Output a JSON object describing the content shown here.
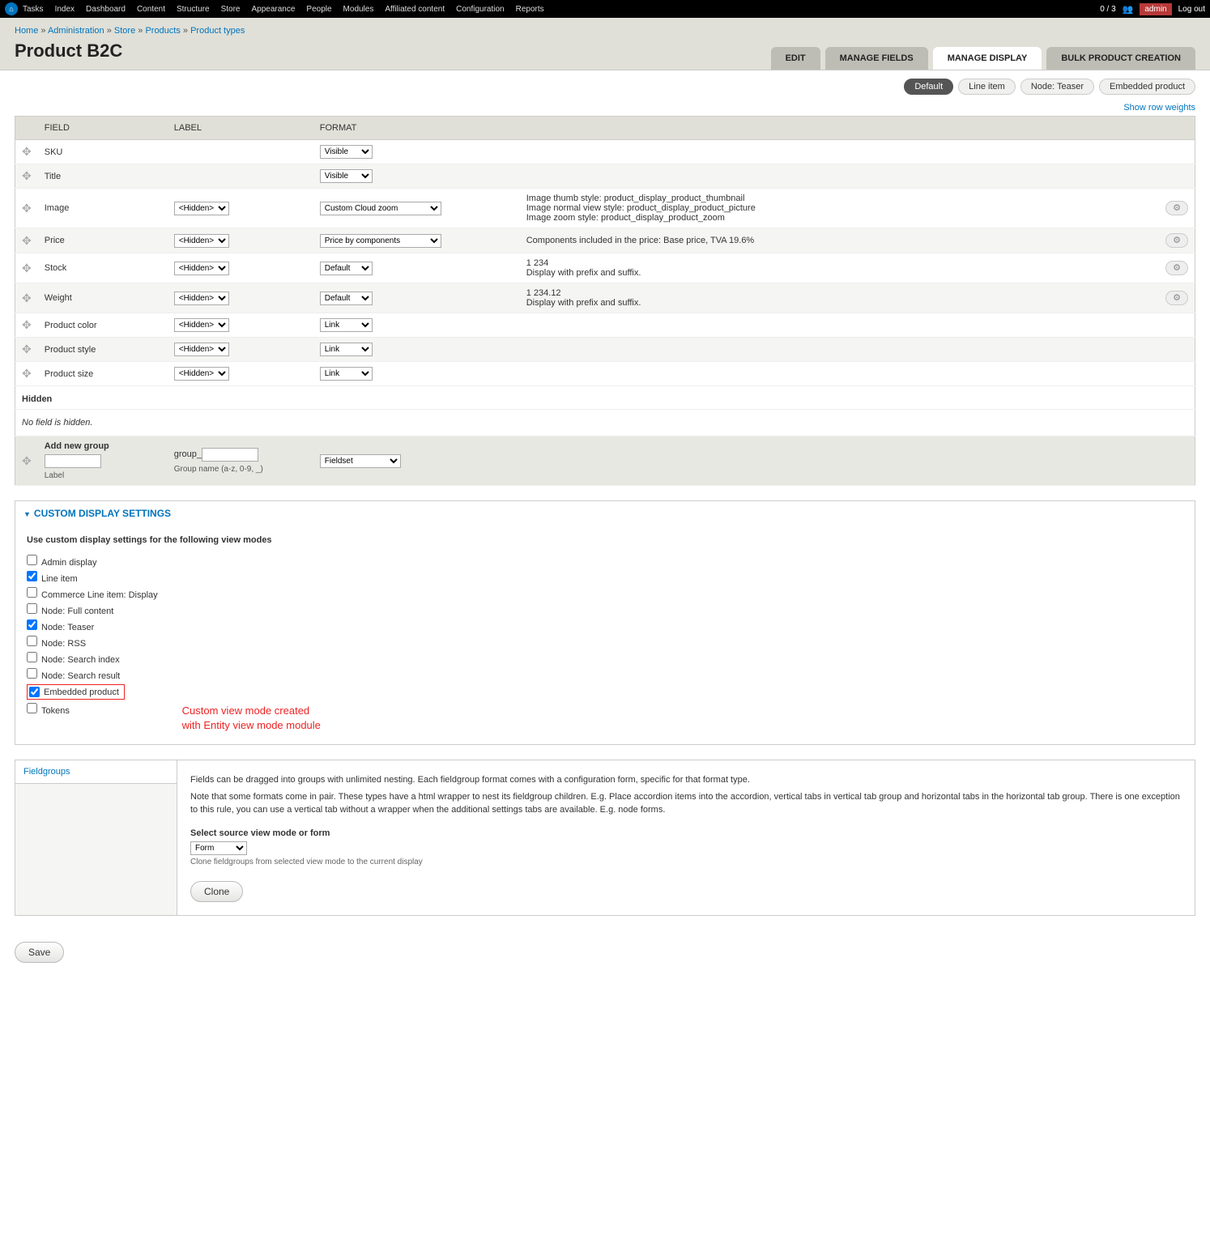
{
  "toolbar": {
    "items": [
      "Tasks",
      "Index",
      "Dashboard",
      "Content",
      "Structure",
      "Store",
      "Appearance",
      "People",
      "Modules",
      "Affiliated content",
      "Configuration",
      "Reports"
    ],
    "right_count": "0 / 3",
    "user": "admin",
    "logout": "Log out"
  },
  "breadcrumb": [
    {
      "label": "Home",
      "link": true
    },
    {
      "label": "Administration",
      "link": true
    },
    {
      "label": "Store",
      "link": true
    },
    {
      "label": "Products",
      "link": true
    },
    {
      "label": "Product types",
      "link": true
    }
  ],
  "page_title": "Product B2C",
  "primary_tabs": [
    {
      "label": "EDIT",
      "active": false
    },
    {
      "label": "MANAGE FIELDS",
      "active": false
    },
    {
      "label": "MANAGE DISPLAY",
      "active": true
    },
    {
      "label": "BULK PRODUCT CREATION",
      "active": false
    }
  ],
  "sub_tabs": [
    {
      "label": "Default",
      "active": true
    },
    {
      "label": "Line item",
      "active": false
    },
    {
      "label": "Node: Teaser",
      "active": false
    },
    {
      "label": "Embedded product",
      "active": false
    }
  ],
  "show_row_weights": "Show row weights",
  "table_headers": {
    "field": "FIELD",
    "label": "LABEL",
    "format": "FORMAT"
  },
  "rows": [
    {
      "field": "SKU",
      "label_sel": null,
      "format_sel": "Visible",
      "summary": "",
      "gear": false
    },
    {
      "field": "Title",
      "label_sel": null,
      "format_sel": "Visible",
      "summary": "",
      "gear": false
    },
    {
      "field": "Image",
      "label_sel": "<Hidden>",
      "format_sel": "Custom Cloud zoom",
      "summary": "Image thumb style: product_display_product_thumbnail\nImage normal view style: product_display_product_picture\nImage zoom style: product_display_product_zoom",
      "gear": true
    },
    {
      "field": "Price",
      "label_sel": "<Hidden>",
      "format_sel": "Price by components",
      "summary": "Components included in the price: Base price, TVA 19.6%",
      "gear": true
    },
    {
      "field": "Stock",
      "label_sel": "<Hidden>",
      "format_sel": "Default",
      "summary": "1 234\nDisplay with prefix and suffix.",
      "gear": true
    },
    {
      "field": "Weight",
      "label_sel": "<Hidden>",
      "format_sel": "Default",
      "summary": "1 234.12\nDisplay with prefix and suffix.",
      "gear": true
    },
    {
      "field": "Product color",
      "label_sel": "<Hidden>",
      "format_sel": "Link",
      "summary": "",
      "gear": false
    },
    {
      "field": "Product style",
      "label_sel": "<Hidden>",
      "format_sel": "Link",
      "summary": "",
      "gear": false
    },
    {
      "field": "Product size",
      "label_sel": "<Hidden>",
      "format_sel": "Link",
      "summary": "",
      "gear": false
    }
  ],
  "hidden_heading": "Hidden",
  "hidden_msg": "No field is hidden.",
  "new_group": {
    "title": "Add new group",
    "label_help": "Label",
    "prefix": "group_",
    "name_help": "Group name (a-z, 0-9, _)",
    "format": "Fieldset"
  },
  "custom_display": {
    "title": "CUSTOM DISPLAY SETTINGS",
    "heading": "Use custom display settings for the following view modes",
    "modes": [
      {
        "label": "Admin display",
        "checked": false,
        "highlight": false
      },
      {
        "label": "Line item",
        "checked": true,
        "highlight": false
      },
      {
        "label": "Commerce Line item: Display",
        "checked": false,
        "highlight": false
      },
      {
        "label": "Node: Full content",
        "checked": false,
        "highlight": false
      },
      {
        "label": "Node: Teaser",
        "checked": true,
        "highlight": false
      },
      {
        "label": "Node: RSS",
        "checked": false,
        "highlight": false
      },
      {
        "label": "Node: Search index",
        "checked": false,
        "highlight": false
      },
      {
        "label": "Node: Search result",
        "checked": false,
        "highlight": false
      },
      {
        "label": "Embedded product",
        "checked": true,
        "highlight": true
      },
      {
        "label": "Tokens",
        "checked": false,
        "highlight": false
      }
    ]
  },
  "annotation": "Custom view mode created with Entity view mode module",
  "fieldgroups": {
    "side_label": "Fieldgroups",
    "p1": "Fields can be dragged into groups with unlimited nesting. Each fieldgroup format comes with a configuration form, specific for that format type.",
    "p2": "Note that some formats come in pair. These types have a html wrapper to nest its fieldgroup children. E.g. Place accordion items into the accordion, vertical tabs in vertical tab group and horizontal tabs in the horizontal tab group. There is one exception to this rule, you can use a vertical tab without a wrapper when the additional settings tabs are available. E.g. node forms.",
    "sub_heading": "Select source view mode or form",
    "select": "Form",
    "desc": "Clone fieldgroups from selected view mode to the current display",
    "clone": "Clone"
  },
  "save_label": "Save"
}
